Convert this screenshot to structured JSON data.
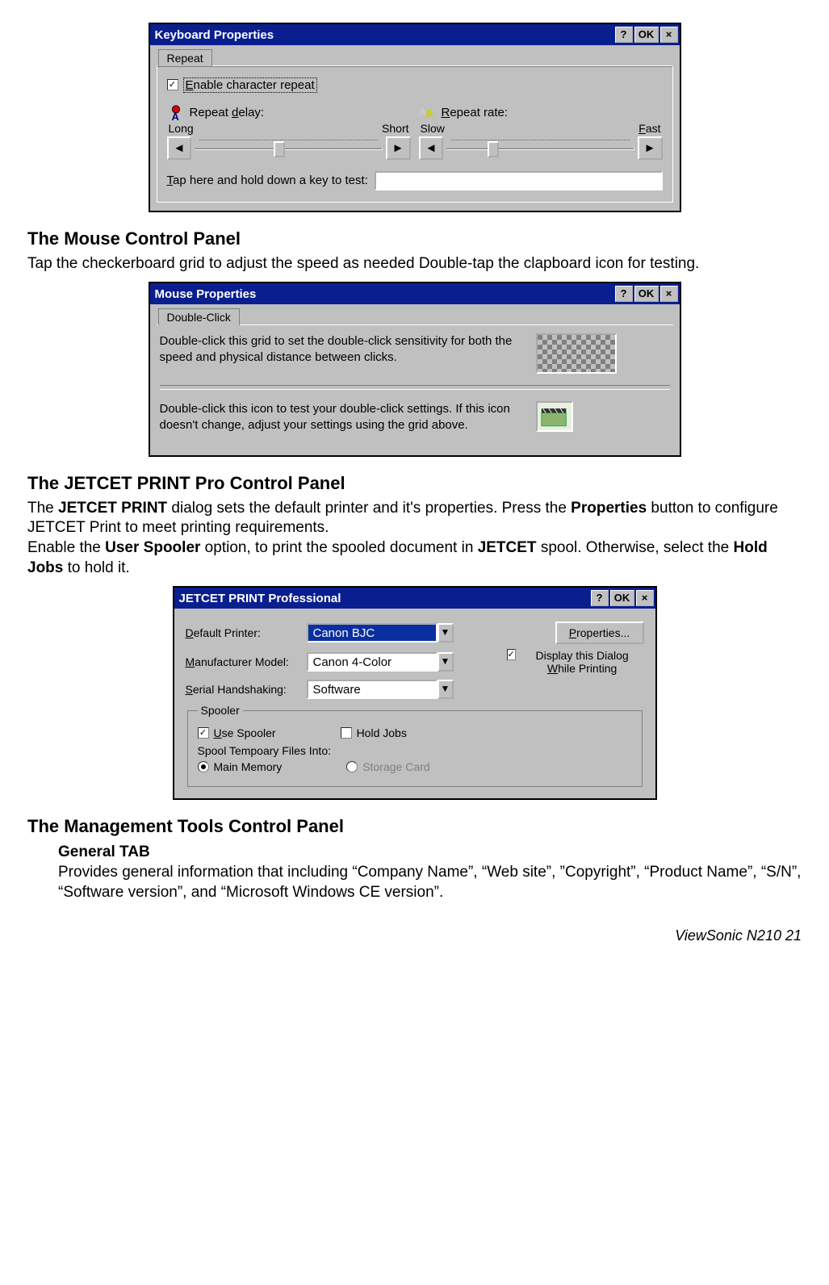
{
  "keyboard_dlg": {
    "title": "Keyboard Properties",
    "help": "?",
    "ok": "OK",
    "close": "×",
    "tab": "Repeat",
    "enable_label": "Enable character repeat",
    "enable_checked": "✓",
    "delay_label": "Repeat delay:",
    "delay_left": "Long",
    "delay_right": "Short",
    "rate_label": "Repeat rate:",
    "rate_left": "Slow",
    "rate_right": "Fast",
    "arrow_left": "◄",
    "arrow_right": "►",
    "test_label": "Tap here and hold down a key to test:"
  },
  "sec_mouse": {
    "heading": "The Mouse Control Panel",
    "body": "Tap the checkerboard grid to adjust the speed as needed Double-tap the clapboard icon for testing."
  },
  "mouse_dlg": {
    "title": "Mouse Properties",
    "help": "?",
    "ok": "OK",
    "close": "×",
    "tab": "Double-Click",
    "para1": "Double-click this grid to set the double-click sensitivity for both the speed and physical distance between clicks.",
    "para2": "Double-click this icon to test your double-click settings. If this icon doesn't change, adjust your settings using the grid above."
  },
  "sec_jetcet": {
    "heading": "The JETCET PRINT Pro Control Panel",
    "body_html": "The <b>JETCET PRINT</b> dialog sets the default printer and it's properties. Press the <b>Properties</b> button to configure JETCET Print to meet printing requirements.<br>Enable the <b>User Spooler</b> option, to print the spooled document in <b>JETCET</b> spool. Otherwise, select the <b>Hold Jobs</b> to hold it."
  },
  "jc_dlg": {
    "title": "JETCET PRINT Professional",
    "help": "?",
    "ok": "OK",
    "close": "×",
    "default_lbl": "Default Printer:",
    "default_val": "Canon BJC",
    "manuf_lbl": "Manufacturer Model:",
    "manuf_val": "Canon 4-Color",
    "serial_lbl": "Serial Handshaking:",
    "serial_val": "Software",
    "prop_btn": "Properties...",
    "display_lbl": "Display this Dialog While Printing",
    "display_checked": "✓",
    "spooler_legend": "Spooler",
    "use_spooler": "Use Spooler",
    "use_spooler_checked": "✓",
    "hold_jobs": "Hold Jobs",
    "spool_into": "Spool Tempoary Files Into:",
    "main_mem": "Main Memory",
    "storage_card": "Storage Card",
    "drop": "▼"
  },
  "sec_mgmt": {
    "heading": "The Management Tools Control Panel",
    "sub": "General TAB",
    "body": "Provides general information that including “Company Name”, “Web site”, ”Copyright”, “Product Name”, “S/N”, “Software version”, and “Microsoft Windows CE version”."
  },
  "footer": "ViewSonic   N210    21"
}
